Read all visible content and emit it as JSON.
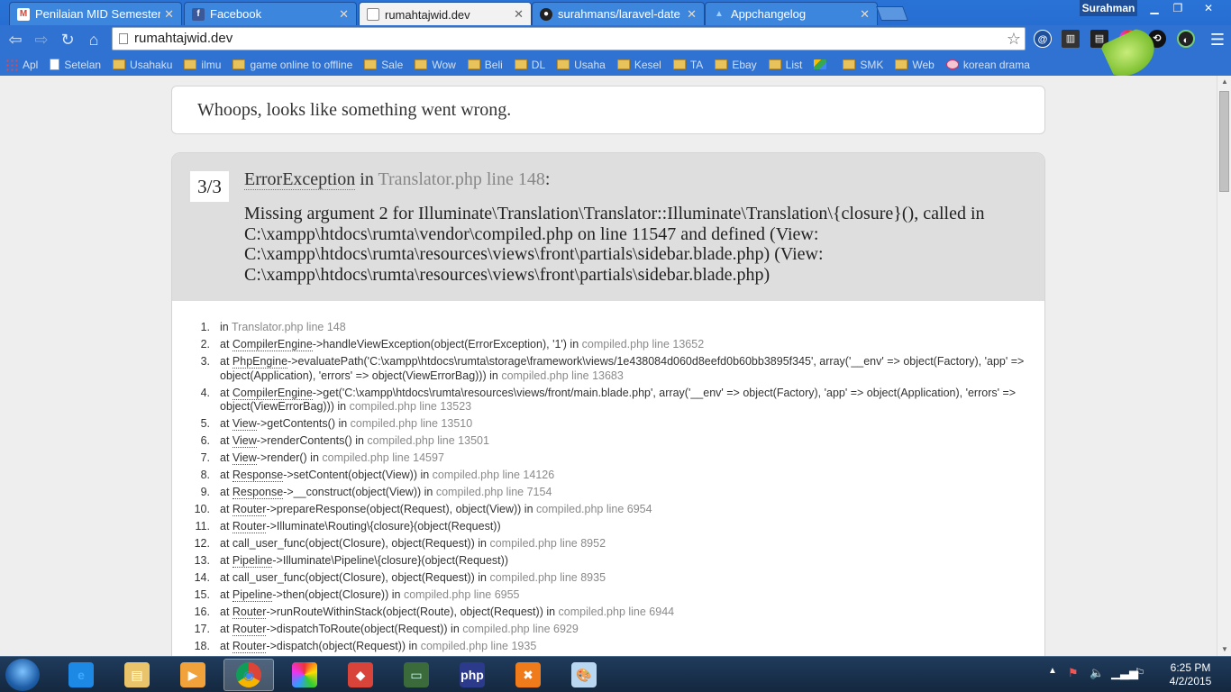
{
  "browser": {
    "tabs": [
      {
        "title": "Penilaian MID Semester G",
        "icon": "gmail-icon",
        "active": false
      },
      {
        "title": "Facebook",
        "icon": "facebook-icon",
        "active": false
      },
      {
        "title": "rumahtajwid.dev",
        "icon": "page-icon",
        "active": true
      },
      {
        "title": "surahmans/laravel-date",
        "icon": "github-icon",
        "active": false
      },
      {
        "title": "Appchangelog",
        "icon": "appchangelog-icon",
        "active": false
      }
    ],
    "profile_name": "Surahman",
    "url": "rumahtajwid.dev",
    "bookmarks": [
      {
        "label": "Apl",
        "icon": "apps-icon"
      },
      {
        "label": "Setelan",
        "icon": "page-icon"
      },
      {
        "label": "Usahaku",
        "icon": "folder-icon"
      },
      {
        "label": "ilmu",
        "icon": "folder-icon"
      },
      {
        "label": "game online to offline",
        "icon": "folder-icon"
      },
      {
        "label": "Sale",
        "icon": "folder-icon"
      },
      {
        "label": "Wow",
        "icon": "folder-icon"
      },
      {
        "label": "Beli",
        "icon": "folder-icon"
      },
      {
        "label": "DL",
        "icon": "folder-icon"
      },
      {
        "label": "Usaha",
        "icon": "folder-icon"
      },
      {
        "label": "Kesel",
        "icon": "folder-icon"
      },
      {
        "label": "TA",
        "icon": "folder-icon"
      },
      {
        "label": "Ebay",
        "icon": "folder-icon"
      },
      {
        "label": "List",
        "icon": "folder-icon"
      },
      {
        "label": "",
        "icon": "google-drive-icon"
      },
      {
        "label": "SMK",
        "icon": "folder-icon"
      },
      {
        "label": "Web",
        "icon": "folder-icon"
      },
      {
        "label": "korean drama",
        "icon": "korean-drama-icon"
      }
    ]
  },
  "page": {
    "whoops": "Whoops, looks like something went wrong.",
    "counter": "3/3",
    "exception_class": "ErrorException",
    "exception_in": " in ",
    "exception_location": "Translator.php line 148",
    "exception_colon": ":",
    "message": "Missing argument 2 for Illuminate\\Translation\\Translator::Illuminate\\Translation\\{closure}(), called in C:\\xampp\\htdocs\\rumta\\vendor\\compiled.php on line 11547 and defined (View: C:\\xampp\\htdocs\\rumta\\resources\\views\\front\\partials\\sidebar.blade.php) (View: C:\\xampp\\htdocs\\rumta\\resources\\views\\front\\partials\\sidebar.blade.php)",
    "trace": [
      {
        "num": "1.",
        "pre": "in ",
        "cls": "",
        "text": "",
        "file": "Translator.php line 148"
      },
      {
        "num": "2.",
        "pre": "at ",
        "cls": "CompilerEngine",
        "text": "->handleViewException(object(ErrorException), '1') in ",
        "file": "compiled.php line 13652"
      },
      {
        "num": "3.",
        "pre": "at ",
        "cls": "PhpEngine",
        "text": "->evaluatePath('C:\\xampp\\htdocs\\rumta\\storage\\framework\\views/1e438084d060d8eefd0b60bb3895f345', array('__env' => object(Factory), 'app' => object(Application), 'errors' => object(ViewErrorBag))) in ",
        "file": "compiled.php line 13683"
      },
      {
        "num": "4.",
        "pre": "at ",
        "cls": "CompilerEngine",
        "text": "->get('C:\\xampp\\htdocs\\rumta\\resources\\views/front/main.blade.php', array('__env' => object(Factory), 'app' => object(Application), 'errors' => object(ViewErrorBag))) in ",
        "file": "compiled.php line 13523"
      },
      {
        "num": "5.",
        "pre": "at ",
        "cls": "View",
        "text": "->getContents() in ",
        "file": "compiled.php line 13510"
      },
      {
        "num": "6.",
        "pre": "at ",
        "cls": "View",
        "text": "->renderContents() in ",
        "file": "compiled.php line 13501"
      },
      {
        "num": "7.",
        "pre": "at ",
        "cls": "View",
        "text": "->render() in ",
        "file": "compiled.php line 14597"
      },
      {
        "num": "8.",
        "pre": "at ",
        "cls": "Response",
        "text": "->setContent(object(View)) in ",
        "file": "compiled.php line 14126"
      },
      {
        "num": "9.",
        "pre": "at ",
        "cls": "Response",
        "text": "->__construct(object(View)) in ",
        "file": "compiled.php line 7154"
      },
      {
        "num": "10.",
        "pre": "at ",
        "cls": "Router",
        "text": "->prepareResponse(object(Request), object(View)) in ",
        "file": "compiled.php line 6954"
      },
      {
        "num": "11.",
        "pre": "at ",
        "cls": "Router",
        "text": "->Illuminate\\Routing\\{closure}(object(Request))",
        "file": ""
      },
      {
        "num": "12.",
        "pre": "at ",
        "cls": "",
        "text": "call_user_func(object(Closure), object(Request)) in ",
        "file": "compiled.php line 8952"
      },
      {
        "num": "13.",
        "pre": "at ",
        "cls": "Pipeline",
        "text": "->Illuminate\\Pipeline\\{closure}(object(Request))",
        "file": ""
      },
      {
        "num": "14.",
        "pre": "at ",
        "cls": "",
        "text": "call_user_func(object(Closure), object(Request)) in ",
        "file": "compiled.php line 8935"
      },
      {
        "num": "15.",
        "pre": "at ",
        "cls": "Pipeline",
        "text": "->then(object(Closure)) in ",
        "file": "compiled.php line 6955"
      },
      {
        "num": "16.",
        "pre": "at ",
        "cls": "Router",
        "text": "->runRouteWithinStack(object(Route), object(Request)) in ",
        "file": "compiled.php line 6944"
      },
      {
        "num": "17.",
        "pre": "at ",
        "cls": "Router",
        "text": "->dispatchToRoute(object(Request)) in ",
        "file": "compiled.php line 6929"
      },
      {
        "num": "18.",
        "pre": "at ",
        "cls": "Router",
        "text": "->dispatch(object(Request)) in ",
        "file": "compiled.php line 1935"
      }
    ]
  },
  "taskbar": {
    "apps": [
      {
        "name": "ie-icon",
        "active": false
      },
      {
        "name": "explorer-icon",
        "active": false
      },
      {
        "name": "media-player-icon",
        "active": false
      },
      {
        "name": "chrome-icon",
        "active": true
      },
      {
        "name": "app-grid-icon",
        "active": false
      },
      {
        "name": "git-icon",
        "active": false
      },
      {
        "name": "terminal-icon",
        "active": false
      },
      {
        "name": "phpstorm-icon",
        "active": false
      },
      {
        "name": "xampp-icon",
        "active": false
      },
      {
        "name": "paint-icon",
        "active": false
      }
    ],
    "time": "6:25 PM",
    "date": "4/2/2015"
  }
}
